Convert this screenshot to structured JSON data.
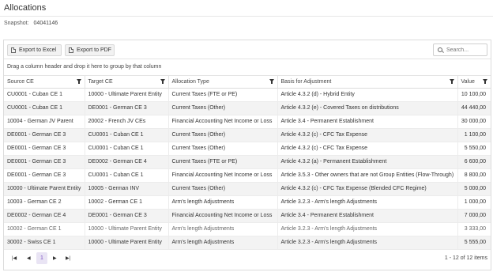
{
  "page": {
    "title": "Allocations"
  },
  "snapshot": {
    "label": "Snapshot:",
    "value": "04041146"
  },
  "toolbar": {
    "export_excel": "Export to Excel",
    "export_pdf": "Export to PDF",
    "search_placeholder": "Search..."
  },
  "group_hint": "Drag a column header and drop it here to group by that column",
  "columns": [
    "Source CE",
    "Target CE",
    "Allocation Type",
    "Basis for Adjustment",
    "Value"
  ],
  "rows": [
    [
      "CU0001 - Cuban CE 1",
      "10000 - Ultimate Parent Entity",
      "Current Taxes (FTE or PE)",
      "Article 4.3.2 (d) - Hybrid Entity",
      "10 100,00"
    ],
    [
      "CU0001 - Cuban CE 1",
      "DE0001 - German CE 3",
      "Current Taxes (Other)",
      "Article 4.3.2 (e) - Covered Taxes on distributions",
      "44 440,00"
    ],
    [
      "10004 - German JV Parent",
      "20002 - French JV CEs",
      "Financial Accounting Net Income or Loss",
      "Article 3.4 - Permanent Establishment",
      "30 000,00"
    ],
    [
      "DE0001 - German CE 3",
      "CU0001 - Cuban CE 1",
      "Current Taxes (Other)",
      "Article 4.3.2 (c) - CFC Tax Expense",
      "1 100,00"
    ],
    [
      "DE0001 - German CE 3",
      "CU0001 - Cuban CE 1",
      "Current Taxes (Other)",
      "Article 4.3.2 (c) - CFC Tax Expense",
      "5 550,00"
    ],
    [
      "DE0001 - German CE 3",
      "DE0002 - German CE 4",
      "Current Taxes (FTE or PE)",
      "Article 4.3.2 (a) - Permanent Establishment",
      "6 600,00"
    ],
    [
      "DE0001 - German CE 3",
      "CU0001 - Cuban CE 1",
      "Financial Accounting Net Income or Loss",
      "Article 3.5.3 - Other owners that are not Group Entities (Flow-Through)",
      "8 800,00"
    ],
    [
      "10000 - Ultimate Parent Entity",
      "10005 - German INV",
      "Current Taxes (Other)",
      "Article 4.3.2 (c) - CFC Tax Expense (Blended CFC Regime)",
      "5 000,00"
    ],
    [
      "10003 - German CE 2",
      "10002 - German CE 1",
      "Arm's length Adjustments",
      "Article 3.2.3 - Arm's length Adjustments",
      "1 000,00"
    ],
    [
      "DE0002 - German CE 4",
      "DE0001 - German CE 3",
      "Financial Accounting Net Income or Loss",
      "Article 3.4 - Permanent Establishment",
      "7 000,00"
    ],
    [
      "10002 - German CE 1",
      "10000 - Ultimate Parent Entity",
      "Arm's length Adjustments",
      "Article 3.2.3 - Arm's length Adjustments",
      "3 333,00"
    ],
    [
      "30002 - Swiss CE 1",
      "10000 - Ultimate Parent Entity",
      "Arm's length Adjustments",
      "Article 3.2.3 - Arm's length Adjustments",
      "5 555,00"
    ]
  ],
  "pager": {
    "first": "⏮",
    "prev": "◀",
    "current": "1",
    "next": "▶",
    "last": "⏭",
    "info": "1 - 12 of 12 items"
  },
  "colors": {
    "accent": "#7a4fc3",
    "accent_bg": "#e9e4f4",
    "row_alt": "#f3f3f3"
  },
  "icons": {
    "export_excel": "document-icon",
    "export_pdf": "document-icon",
    "search": "search-icon",
    "column_filter": "filter-icon"
  }
}
